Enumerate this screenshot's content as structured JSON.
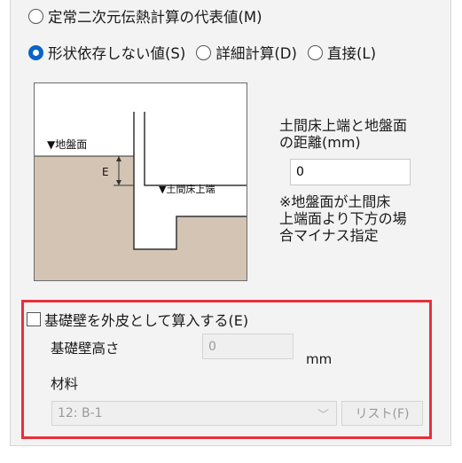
{
  "calc_options": {
    "option_rep_value": "定常二次元伝熱計算の代表値(M)",
    "option_shape_independent": "形状依存しない値(S)",
    "option_detailed": "詳細計算(D)",
    "option_direct": "直接(L)",
    "selected": "形状依存しない値(S)"
  },
  "diagram": {
    "ground_label": "▼地盤面",
    "e_label": "E",
    "floor_label": "▼土間床上端"
  },
  "distance": {
    "label_line1": "土間床上端と地盤面",
    "label_line2": "の距離(mm)",
    "value": "0",
    "note_line1": "※地盤面が土間床",
    "note_line2": "上端面より下方の場",
    "note_line3": "合マイナス指定"
  },
  "foundation": {
    "checkbox_label": "基礎壁を外皮として算入する(E)",
    "checked": false,
    "height_label": "基礎壁高さ",
    "height_value": "0",
    "height_unit": "mm",
    "material_label": "材料",
    "material_value": "12: B-1",
    "list_button": "リスト(F)"
  },
  "colors": {
    "accent": "#0a64c8",
    "highlight": "#e8303a",
    "soil": "#d4c4b4"
  }
}
